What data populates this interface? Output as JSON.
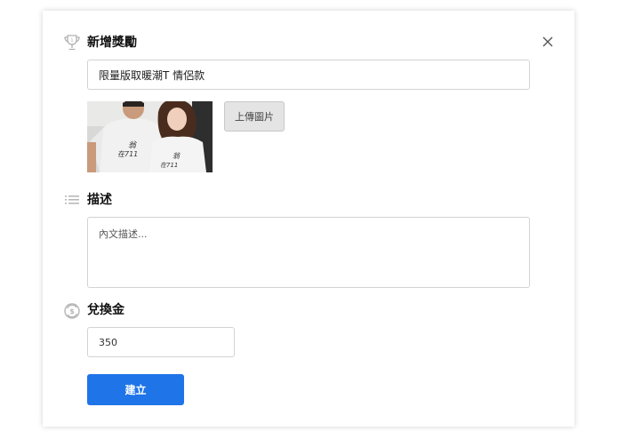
{
  "dialog": {
    "title": "新增獎勵",
    "close_icon": "close-icon"
  },
  "reward": {
    "icon": "trophy-icon",
    "title_value": "限量版取暖潮T 情侶款",
    "upload_label": "上傳圖片"
  },
  "description": {
    "icon": "list-icon",
    "heading": "描述",
    "placeholder": "內文描述..."
  },
  "exchange": {
    "icon": "exchange-coin-icon",
    "heading": "兌換金",
    "value": "350"
  },
  "actions": {
    "create_label": "建立"
  },
  "colors": {
    "primary": "#1f74e8",
    "icon_gray": "#b5b5b5",
    "border": "#d3d3d3"
  }
}
